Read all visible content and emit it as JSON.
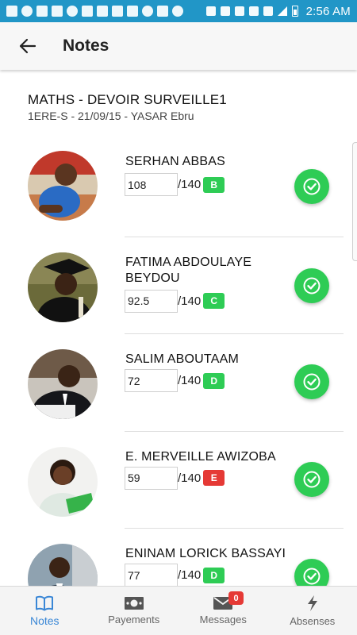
{
  "status_bar": {
    "time": "2:56 AM"
  },
  "app_bar": {
    "title": "Notes"
  },
  "exam": {
    "title": "MATHS - DEVOIR SURVEILLE1",
    "subtitle": "1ERE-S - 21/09/15 - YASAR Ebru"
  },
  "students": [
    {
      "name": "SERHAN ABBAS",
      "grade": "108",
      "max": "/140",
      "letter": "B",
      "letter_color": "green"
    },
    {
      "name": "FATIMA ABDOULAYE BEYDOU",
      "grade": "92.5",
      "max": "/140",
      "letter": "C",
      "letter_color": "green"
    },
    {
      "name": "SALIM ABOUTAAM",
      "grade": "72",
      "max": "/140",
      "letter": "D",
      "letter_color": "green"
    },
    {
      "name": "E. MERVEILLE AWIZOBA",
      "grade": "59",
      "max": "/140",
      "letter": "E",
      "letter_color": "red"
    },
    {
      "name": "ENINAM LORICK BASSAYI",
      "grade": "77",
      "max": "/140",
      "letter": "D",
      "letter_color": "green"
    }
  ],
  "bottom_nav": {
    "items": [
      {
        "label": "Notes",
        "icon": "book-icon",
        "active": true
      },
      {
        "label": "Payements",
        "icon": "money-icon",
        "active": false
      },
      {
        "label": "Messages",
        "icon": "mail-icon",
        "active": false,
        "badge": "0"
      },
      {
        "label": "Absenses",
        "icon": "lightning-icon",
        "active": false
      }
    ]
  },
  "colors": {
    "status_bar": "#2196c7",
    "success": "#2ecc55",
    "danger": "#e53935",
    "active_nav": "#3a87d6"
  }
}
